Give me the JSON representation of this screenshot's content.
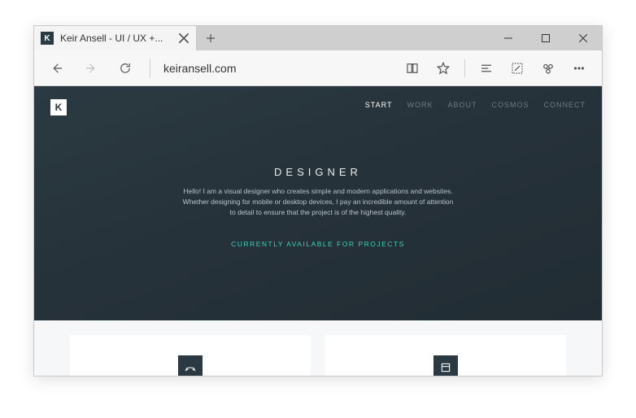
{
  "tab": {
    "title": "Keir Ansell - UI / UX +...",
    "favicon_letter": "K"
  },
  "address": {
    "url": "keiransell.com"
  },
  "site": {
    "brand_letter": "K",
    "nav": [
      {
        "label": "START",
        "active": true
      },
      {
        "label": "WORK",
        "active": false
      },
      {
        "label": "ABOUT",
        "active": false
      },
      {
        "label": "COSMOS",
        "active": false
      },
      {
        "label": "CONNECT",
        "active": false
      }
    ],
    "hero": {
      "title": "DESIGNER",
      "description": "Hello! I am a visual designer who creates simple and modern applications and websites. Whether designing for mobile or desktop devices, I pay an incredible amount of attention to detail to ensure that the project is of the highest quality.",
      "cta": "CURRENTLY AVAILABLE FOR PROJECTS"
    },
    "cards": [
      {
        "icon": "pen-tool"
      },
      {
        "icon": "layout"
      }
    ]
  }
}
